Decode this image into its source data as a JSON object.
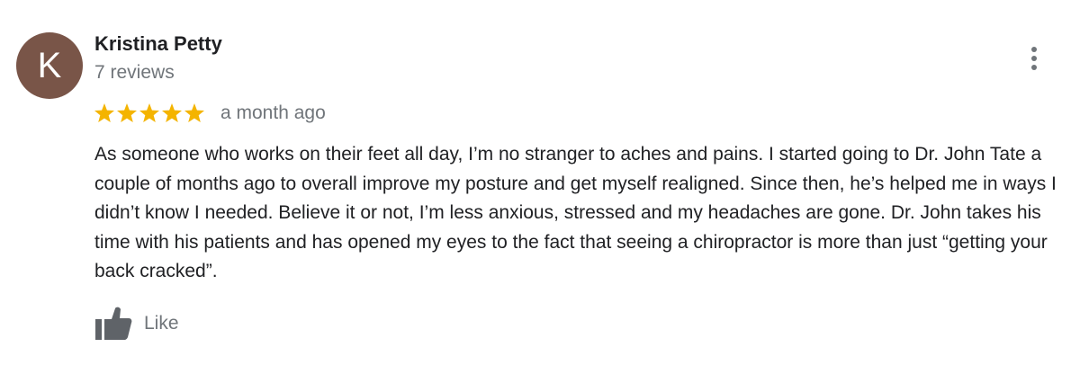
{
  "review": {
    "avatar_letter": "K",
    "avatar_color": "#795548",
    "author_name": "Kristina Petty",
    "review_count": "7 reviews",
    "rating": 5,
    "rating_max": 5,
    "star_color": "#f4b400",
    "time_ago": "a month ago",
    "text": "As someone who works on their feet all day, I’m no stranger to aches and pains. I started going to Dr. John Tate a couple of months ago to overall improve my posture and get myself realigned. Since then, he’s helped me in ways I didn’t know I needed. Believe it or not, I’m less anxious, stressed and my headaches are gone. Dr. John takes his time with his patients and has opened my eyes to the fact that seeing a chiropractor is more than just “getting your back cracked”.",
    "like_label": "Like",
    "more_icon": "more-vert-icon",
    "like_icon": "thumb-up-icon"
  }
}
